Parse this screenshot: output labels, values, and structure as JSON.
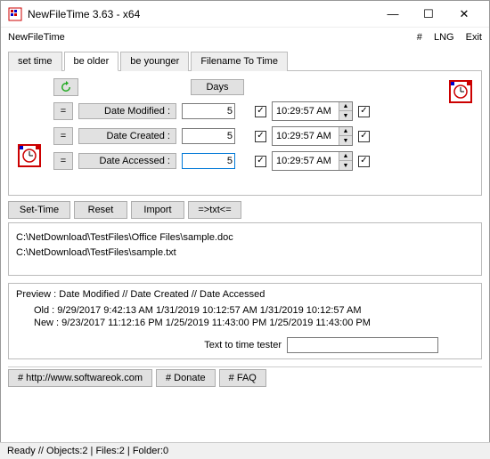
{
  "window": {
    "title": "NewFileTime 3.63 - x64"
  },
  "menu": {
    "hash": "#",
    "lng": "LNG",
    "exit": "Exit",
    "app": "NewFileTime"
  },
  "tabs": {
    "set_time": "set time",
    "be_older": "be older",
    "be_younger": "be younger",
    "filename": "Filename To Time"
  },
  "panel": {
    "eq": "=",
    "days_label": "Days",
    "rows": [
      {
        "label": "Date Modified :",
        "days": "5",
        "time": "10:29:57 AM"
      },
      {
        "label": "Date Created :",
        "days": "5",
        "time": "10:29:57 AM"
      },
      {
        "label": "Date Accessed :",
        "days": "5",
        "time": "10:29:57 AM"
      }
    ]
  },
  "actions": {
    "set": "Set-Time",
    "reset": "Reset",
    "import": "Import",
    "txt": "=>txt<="
  },
  "files": [
    "C:\\NetDownload\\TestFiles\\Office Files\\sample.doc",
    "C:\\NetDownload\\TestFiles\\sample.txt"
  ],
  "preview": {
    "header": "Preview :   Date Modified   //   Date Created   //   Date Accessed",
    "old": "Old :  9/29/2017 9:42:13 AM   1/31/2019 10:12:57 AM  1/31/2019 10:12:57 AM",
    "new": "New :  9/23/2017 11:12:16 PM  1/25/2019 11:43:00 PM  1/25/2019 11:43:00 PM"
  },
  "tester": {
    "label": "Text to time tester",
    "value": ""
  },
  "links": {
    "site": "# http://www.softwareok.com",
    "donate": "# Donate",
    "faq": "# FAQ"
  },
  "status": "Ready // Objects:2 | Files:2 | Folder:0"
}
